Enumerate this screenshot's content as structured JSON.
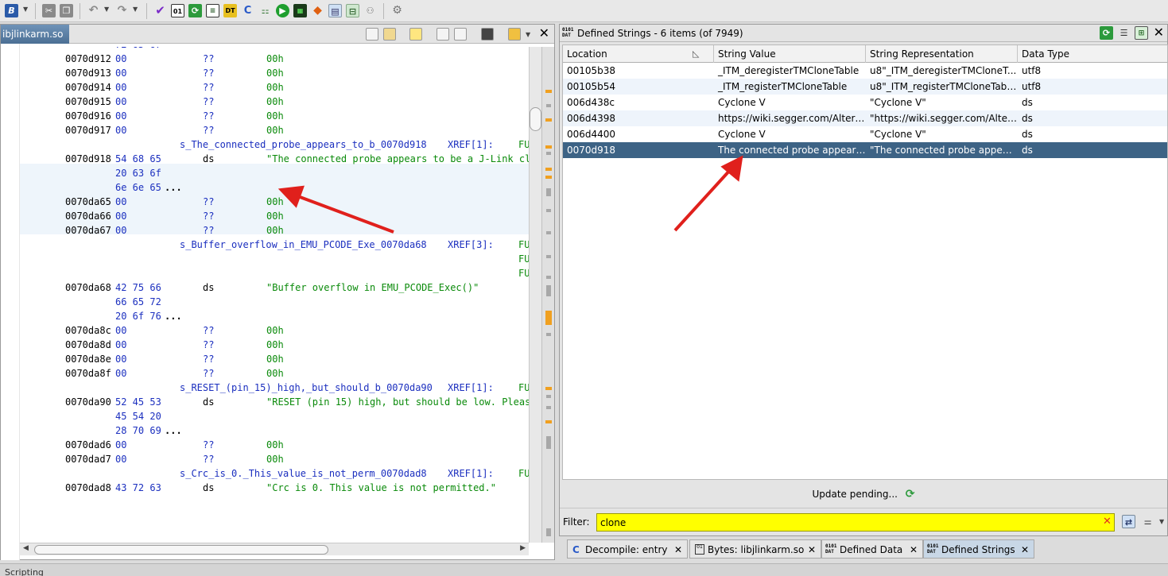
{
  "toolbar": {
    "icons": [
      "ghidra-b-icon",
      "cut-icon",
      "copy-icon",
      "undo-icon",
      "redo-icon",
      "checkmark-icon",
      "bytes-icon",
      "refresh-icon",
      "listing-icon",
      "data-type-icon",
      "decompile-icon",
      "function-graph-icon",
      "run-icon",
      "memory-map-icon",
      "bookmark-icon",
      "table-icon",
      "tree-icon",
      "gear-icon"
    ]
  },
  "left_panel": {
    "title": "ibjlinkarm.so",
    "listing": [
      {
        "kind": "partial",
        "bytes": "72 65 67"
      },
      {
        "kind": "row",
        "addr": "0070d912",
        "bytes": "00",
        "mnem": "??",
        "oper": "00h"
      },
      {
        "kind": "row",
        "addr": "0070d913",
        "bytes": "00",
        "mnem": "??",
        "oper": "00h"
      },
      {
        "kind": "row",
        "addr": "0070d914",
        "bytes": "00",
        "mnem": "??",
        "oper": "00h"
      },
      {
        "kind": "row",
        "addr": "0070d915",
        "bytes": "00",
        "mnem": "??",
        "oper": "00h"
      },
      {
        "kind": "row",
        "addr": "0070d916",
        "bytes": "00",
        "mnem": "??",
        "oper": "00h"
      },
      {
        "kind": "row",
        "addr": "0070d917",
        "bytes": "00",
        "mnem": "??",
        "oper": "00h"
      },
      {
        "kind": "label",
        "label": "s_The_connected_probe_appears_to_b_0070d918",
        "xref": "XREF[1]:",
        "fun": "FU"
      },
      {
        "kind": "ds",
        "addr": "0070d918",
        "bytes": "54 68 65",
        "mnem": "ds",
        "oper": "\"The connected probe appears to be a J-Link cl..."
      },
      {
        "kind": "cont",
        "bytes": "20 63 6f"
      },
      {
        "kind": "cont",
        "bytes": "6e 6e 65",
        "more": "..."
      },
      {
        "kind": "row",
        "addr": "0070da65",
        "bytes": "00",
        "mnem": "??",
        "oper": "00h"
      },
      {
        "kind": "row",
        "addr": "0070da66",
        "bytes": "00",
        "mnem": "??",
        "oper": "00h"
      },
      {
        "kind": "row",
        "addr": "0070da67",
        "bytes": "00",
        "mnem": "??",
        "oper": "00h"
      },
      {
        "kind": "label",
        "label": "s_Buffer_overflow_in_EMU_PCODE_Exe_0070da68",
        "xref": "XREF[3]:",
        "fun": "FU"
      },
      {
        "kind": "fun",
        "fun": "FU"
      },
      {
        "kind": "fun",
        "fun": "FU"
      },
      {
        "kind": "ds",
        "addr": "0070da68",
        "bytes": "42 75 66",
        "mnem": "ds",
        "oper": "\"Buffer overflow in EMU_PCODE_Exec()\""
      },
      {
        "kind": "cont",
        "bytes": "66 65 72"
      },
      {
        "kind": "cont",
        "bytes": "20 6f 76",
        "more": "..."
      },
      {
        "kind": "row",
        "addr": "0070da8c",
        "bytes": "00",
        "mnem": "??",
        "oper": "00h"
      },
      {
        "kind": "row",
        "addr": "0070da8d",
        "bytes": "00",
        "mnem": "??",
        "oper": "00h"
      },
      {
        "kind": "row",
        "addr": "0070da8e",
        "bytes": "00",
        "mnem": "??",
        "oper": "00h"
      },
      {
        "kind": "row",
        "addr": "0070da8f",
        "bytes": "00",
        "mnem": "??",
        "oper": "00h"
      },
      {
        "kind": "label",
        "label": "s_RESET_(pin_15)_high,_but_should_b_0070da90",
        "xref": "XREF[1]:",
        "fun": "FU"
      },
      {
        "kind": "ds",
        "addr": "0070da90",
        "bytes": "52 45 53",
        "mnem": "ds",
        "oper": "\"RESET (pin 15) high, but should be low. Pleas..."
      },
      {
        "kind": "cont",
        "bytes": "45 54 20"
      },
      {
        "kind": "cont",
        "bytes": "28 70 69",
        "more": "..."
      },
      {
        "kind": "row",
        "addr": "0070dad6",
        "bytes": "00",
        "mnem": "??",
        "oper": "00h"
      },
      {
        "kind": "row",
        "addr": "0070dad7",
        "bytes": "00",
        "mnem": "??",
        "oper": "00h"
      },
      {
        "kind": "label",
        "label": "s_Crc_is_0._This_value_is_not_perm_0070dad8",
        "xref": "XREF[1]:",
        "fun": "FU"
      },
      {
        "kind": "ds",
        "addr": "0070dad8",
        "bytes": "43 72 63",
        "mnem": "ds",
        "oper": "\"Crc is 0. This value is not permitted.\""
      }
    ]
  },
  "right_panel": {
    "title": "Defined Strings - 6 items (of 7949)",
    "columns": [
      "Location",
      "String Value",
      "String Representation",
      "Data Type"
    ],
    "rows": [
      [
        "00105b38",
        "_ITM_deregisterTMCloneTable",
        "u8\"_ITM_deregisterTMCloneT...",
        "utf8"
      ],
      [
        "00105b54",
        "_ITM_registerTMCloneTable",
        "u8\"_ITM_registerTMCloneTable\"",
        "utf8"
      ],
      [
        "006d438c",
        "Cyclone V",
        "\"Cyclone V\"",
        "ds"
      ],
      [
        "006d4398",
        "https://wiki.segger.com/Altera_...",
        "\"https://wiki.segger.com/Altera...",
        "ds"
      ],
      [
        "006d4400",
        "Cyclone V",
        "\"Cyclone V\"",
        "ds"
      ],
      [
        "0070d918",
        "The connected probe appears ...",
        "\"The connected probe appears...",
        "ds"
      ]
    ],
    "selected_row": 5,
    "update_text": "Update pending...",
    "filter_label": "Filter:",
    "filter_value": "clone"
  },
  "tabs": [
    {
      "label": "Decompile: entry",
      "icon": "decompile-icon"
    },
    {
      "label": "Bytes: libjlinkarm.so",
      "icon": "bytes-icon"
    },
    {
      "label": "Defined Data",
      "icon": "data-icon"
    },
    {
      "label": "Defined Strings",
      "icon": "data-icon",
      "active": true
    }
  ],
  "status": {
    "label": "Scripting"
  },
  "colors": {
    "accent": "#3d6385",
    "filter_bg": "#ffff00",
    "annotation_arrow": "#e0201c"
  }
}
